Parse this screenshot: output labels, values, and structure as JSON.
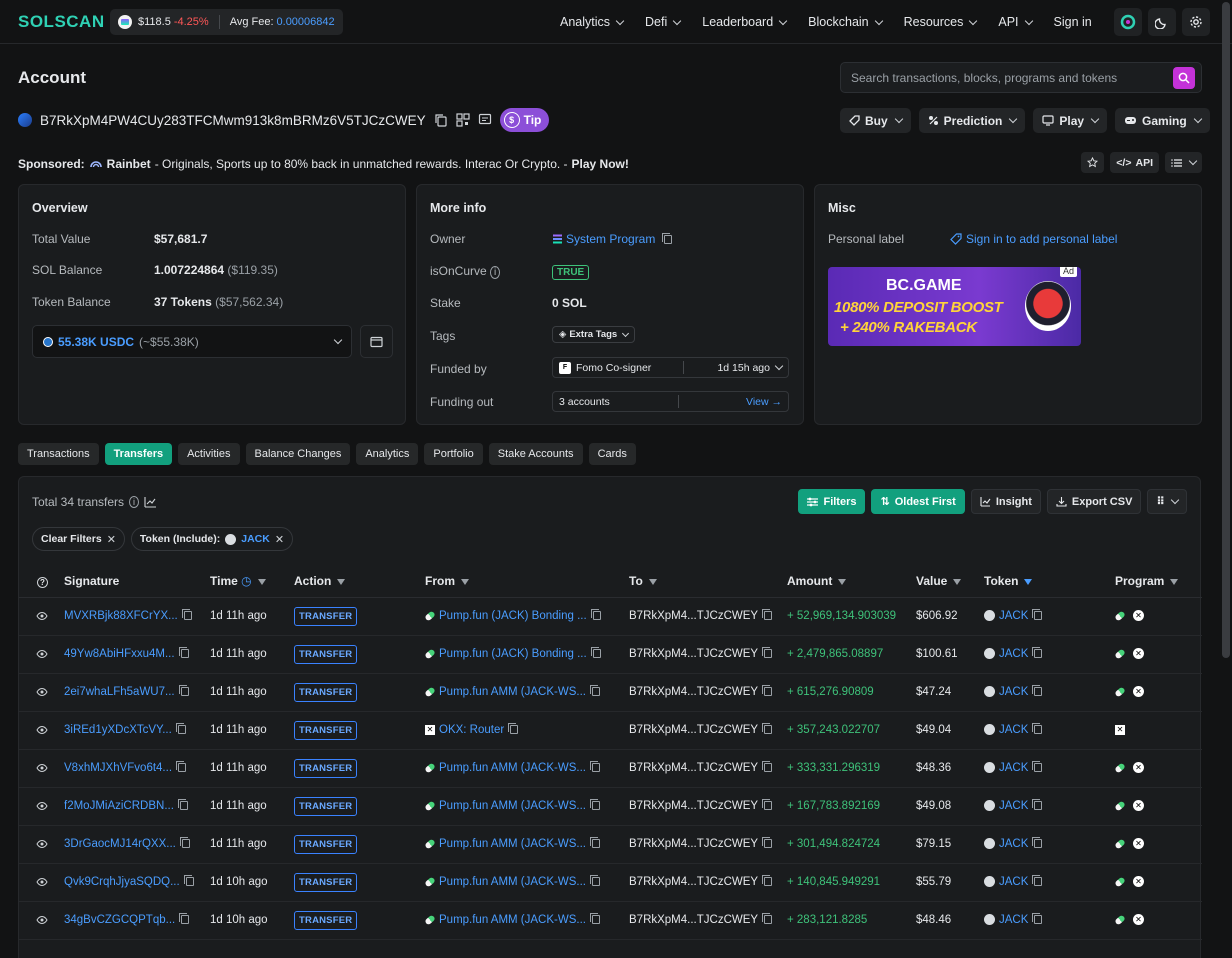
{
  "nav": {
    "logo": "SOLSCAN",
    "sol_price": "$118.5",
    "sol_change": "-4.25%",
    "avg_fee_label": "Avg Fee:",
    "avg_fee_value": "0.00006842",
    "links": [
      "Analytics",
      "Defi",
      "Leaderboard",
      "Blockchain",
      "Resources",
      "API"
    ],
    "sign_in": "Sign in"
  },
  "header": {
    "title": "Account",
    "search_placeholder": "Search transactions, blocks, programs and tokens",
    "address": "B7RkXpM4PW4CUy283TFCMwm913k8mBRMz6V5TJCzCWEY",
    "tip": "Tip",
    "buttons": [
      "Buy",
      "Prediction",
      "Play",
      "Gaming"
    ]
  },
  "sponsored": {
    "label": "Sponsored:",
    "brand": "Rainbet",
    "text": "- Originals, Sports up to 80% back in unmatched rewards. Interac Or Crypto. -",
    "cta": "Play Now!"
  },
  "toolbar_small": {
    "api": "API"
  },
  "overview": {
    "title": "Overview",
    "total_value_label": "Total Value",
    "total_value": "$57,681.7",
    "sol_balance_label": "SOL Balance",
    "sol_balance": "1.007224864",
    "sol_balance_usd": "($119.35)",
    "token_balance_label": "Token Balance",
    "token_balance": "37 Tokens",
    "token_balance_usd": "($57,562.34)",
    "usdc_amount": "55.38K USDC",
    "usdc_usd": "(~$55.38K)"
  },
  "moreinfo": {
    "title": "More info",
    "owner_label": "Owner",
    "owner": "System Program",
    "oncurve_label": "isOnCurve",
    "oncurve": "TRUE",
    "stake_label": "Stake",
    "stake": "0 SOL",
    "tags_label": "Tags",
    "tags": "Extra Tags",
    "funded_label": "Funded by",
    "funded_by": "Fomo Co-signer",
    "funded_time": "1d 15h ago",
    "funding_out_label": "Funding out",
    "funding_out": "3 accounts",
    "view": "View →"
  },
  "misc": {
    "title": "Misc",
    "personal_label": "Personal label",
    "sign_in_label": "Sign in to add personal label",
    "ad_tag": "Ad",
    "ad_brand": "BC.GAME",
    "ad_line1": "1080% DEPOSIT BOOST",
    "ad_line2": "+ 240% RAKEBACK"
  },
  "tabs": [
    "Transactions",
    "Transfers",
    "Activities",
    "Balance Changes",
    "Analytics",
    "Portfolio",
    "Stake Accounts",
    "Cards"
  ],
  "table": {
    "total": "Total 34 transfers",
    "buttons": {
      "filters": "Filters",
      "oldest": "Oldest First",
      "insight": "Insight",
      "export": "Export CSV"
    },
    "chips": {
      "clear": "Clear Filters",
      "token_label": "Token (Include):",
      "token": "JACK"
    },
    "headers": [
      "Signature",
      "Time",
      "Action",
      "From",
      "To",
      "Amount",
      "Value",
      "Token",
      "Program"
    ],
    "rows": [
      {
        "sig": "MVXRBjk88XFCrYX...",
        "time": "1d 11h ago",
        "action": "TRANSFER",
        "from": "Pump.fun (JACK) Bonding ...",
        "from_type": "pump",
        "to": "B7RkXpM4...TJCzCWEY",
        "amount": "+ 52,969,134.903039",
        "value": "$606.92",
        "token": "JACK",
        "prog2": true
      },
      {
        "sig": "49Yw8AbiHFxxu4M...",
        "time": "1d 11h ago",
        "action": "TRANSFER",
        "from": "Pump.fun (JACK) Bonding ...",
        "from_type": "pump",
        "to": "B7RkXpM4...TJCzCWEY",
        "amount": "+ 2,479,865.08897",
        "value": "$100.61",
        "token": "JACK",
        "prog2": true
      },
      {
        "sig": "2ei7whaLFh5aWU7...",
        "time": "1d 11h ago",
        "action": "TRANSFER",
        "from": "Pump.fun AMM (JACK-WS...",
        "from_type": "pump",
        "to": "B7RkXpM4...TJCzCWEY",
        "amount": "+ 615,276.90809",
        "value": "$47.24",
        "token": "JACK",
        "prog2": true
      },
      {
        "sig": "3iREd1yXDcXTcVY...",
        "time": "1d 11h ago",
        "action": "TRANSFER",
        "from": "OKX: Router",
        "from_type": "okx",
        "to": "B7RkXpM4...TJCzCWEY",
        "amount": "+ 357,243.022707",
        "value": "$49.04",
        "token": "JACK",
        "prog2": false
      },
      {
        "sig": "V8xhMJXhVFvo6t4...",
        "time": "1d 11h ago",
        "action": "TRANSFER",
        "from": "Pump.fun AMM (JACK-WS...",
        "from_type": "pump",
        "to": "B7RkXpM4...TJCzCWEY",
        "amount": "+ 333,331.296319",
        "value": "$48.36",
        "token": "JACK",
        "prog2": true
      },
      {
        "sig": "f2MoJMiAziCRDBN...",
        "time": "1d 11h ago",
        "action": "TRANSFER",
        "from": "Pump.fun AMM (JACK-WS...",
        "from_type": "pump",
        "to": "B7RkXpM4...TJCzCWEY",
        "amount": "+ 167,783.892169",
        "value": "$49.08",
        "token": "JACK",
        "prog2": true
      },
      {
        "sig": "3DrGaocMJ14rQXX...",
        "time": "1d 11h ago",
        "action": "TRANSFER",
        "from": "Pump.fun AMM (JACK-WS...",
        "from_type": "pump",
        "to": "B7RkXpM4...TJCzCWEY",
        "amount": "+ 301,494.824724",
        "value": "$79.15",
        "token": "JACK",
        "prog2": true
      },
      {
        "sig": "Qvk9CrqhJjyaSQDQ...",
        "time": "1d 10h ago",
        "action": "TRANSFER",
        "from": "Pump.fun AMM (JACK-WS...",
        "from_type": "pump",
        "to": "B7RkXpM4...TJCzCWEY",
        "amount": "+ 140,845.949291",
        "value": "$55.79",
        "token": "JACK",
        "prog2": true
      },
      {
        "sig": "34gBvCZGCQPTqb...",
        "time": "1d 10h ago",
        "action": "TRANSFER",
        "from": "Pump.fun AMM (JACK-WS...",
        "from_type": "pump",
        "to": "B7RkXpM4...TJCzCWEY",
        "amount": "+ 283,121.8285",
        "value": "$48.46",
        "token": "JACK",
        "prog2": true
      }
    ]
  }
}
